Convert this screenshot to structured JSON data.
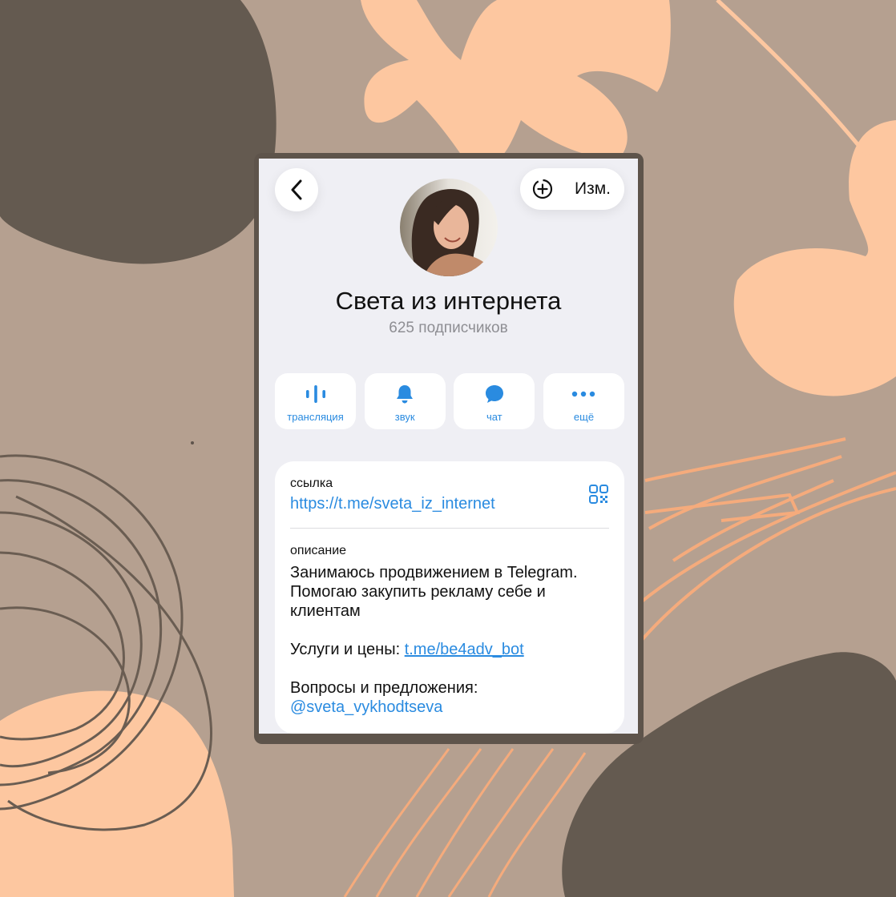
{
  "colors": {
    "background": "#b5a090",
    "blob_dark": "#645a50",
    "blob_peach": "#fdc7a0",
    "accent_blue": "#2a8be0"
  },
  "header": {
    "back_icon": "chevron-left-icon",
    "add_story_icon": "plus-circle-dashed-icon",
    "edit_label": "Изм."
  },
  "profile": {
    "name": "Света из интернета",
    "subscribers": "625 подписчиков"
  },
  "actions": [
    {
      "label": "трансляция",
      "icon": "livestream-icon"
    },
    {
      "label": "звук",
      "icon": "bell-icon"
    },
    {
      "label": "чат",
      "icon": "chat-bubble-icon"
    },
    {
      "label": "ещё",
      "icon": "more-dots-icon"
    }
  ],
  "info": {
    "link_label": "ссылка",
    "link_value": "https://t.me/sveta_iz_internet",
    "qr_icon": "qr-code-icon",
    "description_label": "описание",
    "description_line1": "Занимаюсь продвижением в Telegram.",
    "description_line2": "Помогаю закупить рекламу себе и",
    "description_line3": "клиентам",
    "services_prefix": "Услуги и цены: ",
    "services_link": "t.me/be4adv_bot",
    "questions_label": "Вопросы и предложения:",
    "questions_handle": "@sveta_vykhodtseva"
  }
}
